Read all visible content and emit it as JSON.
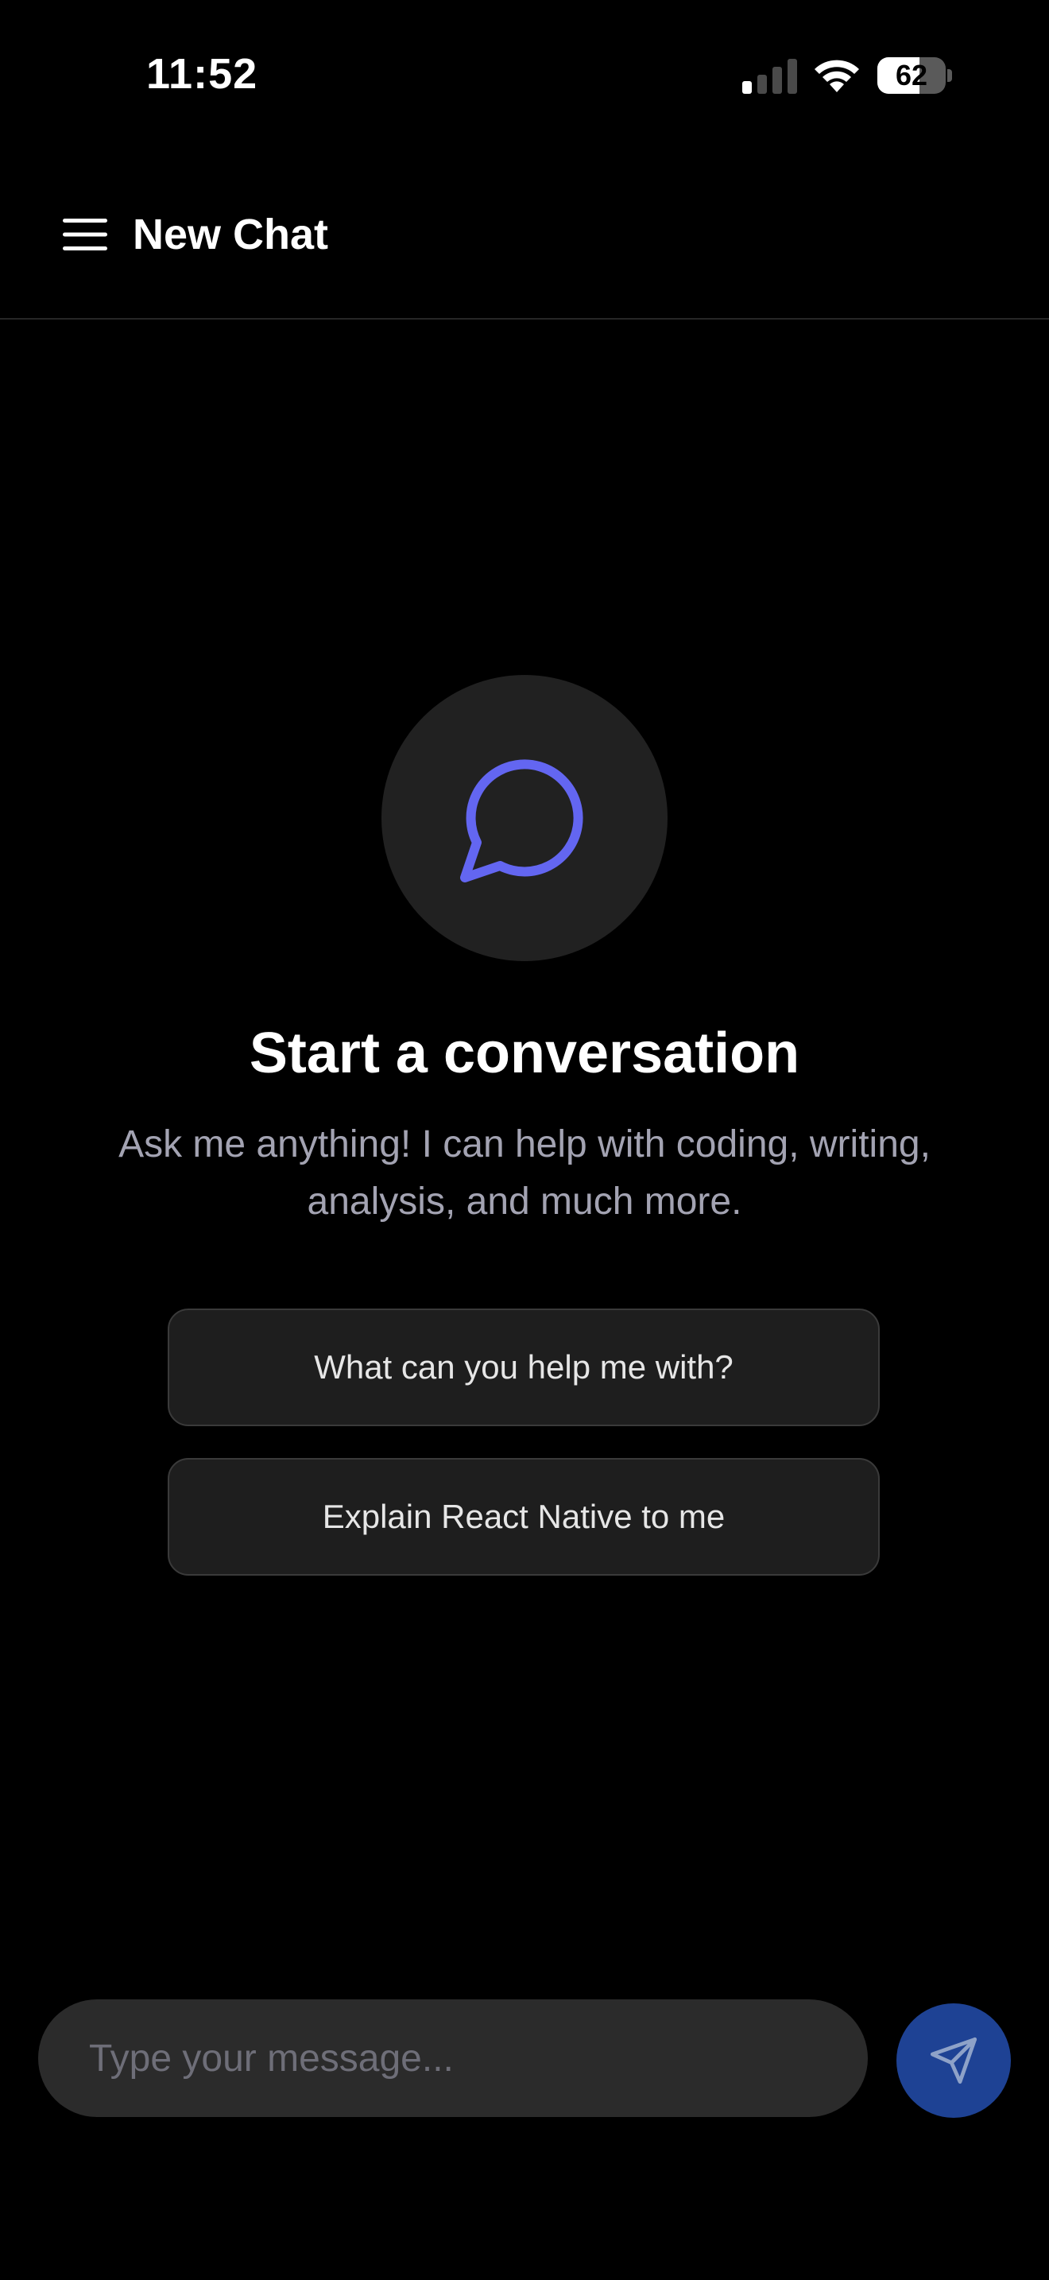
{
  "status_bar": {
    "time": "11:52",
    "battery_level": "62",
    "battery_fraction": 0.62,
    "signal_bars_active": 1,
    "signal_bars_total": 4,
    "icons": [
      "signal-icon",
      "wifi-icon",
      "battery-icon"
    ]
  },
  "header": {
    "title": "New Chat",
    "menu_icon": "hamburger-menu-icon"
  },
  "empty_state": {
    "icon": "chat-bubble-icon",
    "title": "Start a conversation",
    "subtitle": "Ask me anything! I can help with coding, writing, analysis, and much more."
  },
  "suggestions": [
    {
      "label": "What can you help me with?"
    },
    {
      "label": "Explain React Native to me"
    }
  ],
  "composer": {
    "placeholder": "Type your message...",
    "value": "",
    "send_icon": "send-icon"
  },
  "colors": {
    "background": "#000000",
    "accent": "#6366f1",
    "send_button": "#1e4294",
    "card": "#1e1e1e",
    "subtitle": "#a3a3b2"
  }
}
